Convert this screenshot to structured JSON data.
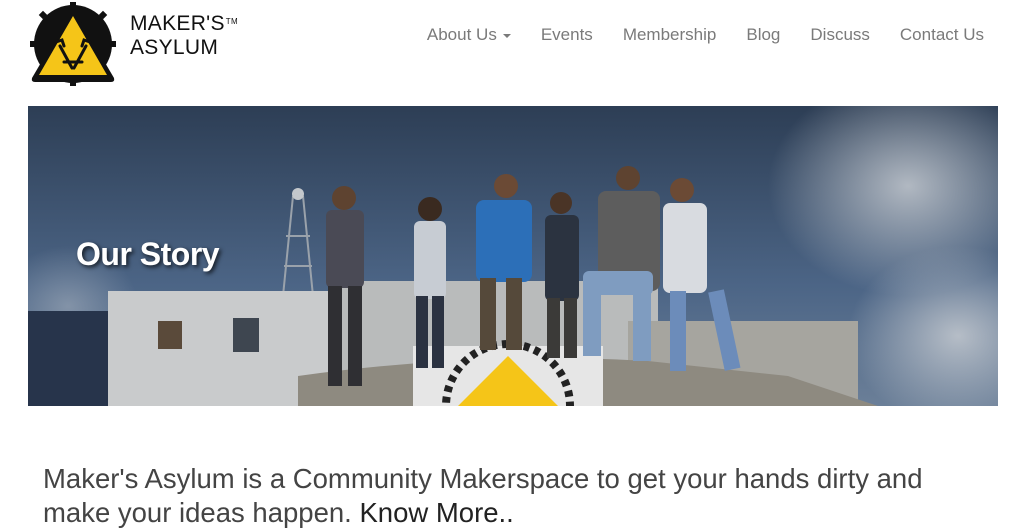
{
  "brand": {
    "line1": "MAKER'S",
    "line2": "ASYLUM",
    "tm": "TM"
  },
  "nav": {
    "about": "About Us",
    "events": "Events",
    "membership": "Membership",
    "blog": "Blog",
    "discuss": "Discuss",
    "contact": "Contact Us"
  },
  "hero": {
    "title": "Our Story"
  },
  "tagline": {
    "text": "Maker's Asylum is a Community Makerspace to get your hands dirty and make your ideas happen.",
    "link": "Know More.."
  },
  "colors": {
    "accent": "#f5c518",
    "nav_text": "#7a7a7a",
    "body_text": "#444444"
  }
}
